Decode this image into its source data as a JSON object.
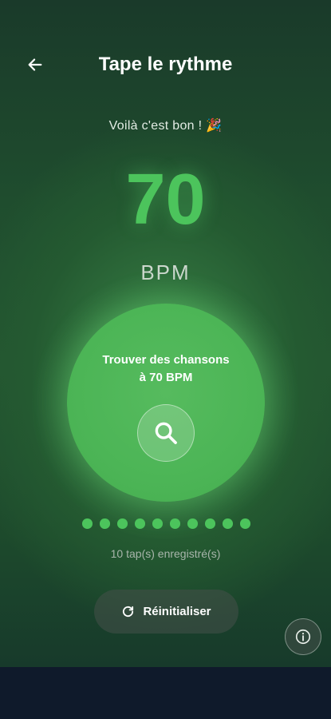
{
  "header": {
    "title": "Tape le rythme",
    "back_icon": "arrow-left-icon"
  },
  "status_message": "Voilà c'est bon ! 🎉",
  "bpm": {
    "value": "70",
    "unit": "BPM"
  },
  "tap_button": {
    "line1": "Trouver des chansons",
    "line2": "à 70 BPM",
    "icon": "search-icon"
  },
  "taps": {
    "recorded": 10,
    "label": "10 tap(s) enregistré(s)"
  },
  "reset_button": {
    "label": "Réinitialiser",
    "icon": "refresh-icon"
  },
  "info_button": {
    "icon": "info-icon"
  },
  "colors": {
    "accent": "#4cc45c",
    "circle": "#4cb556",
    "background": "#1f4d2e",
    "nav_bar": "#0f1a2b"
  }
}
